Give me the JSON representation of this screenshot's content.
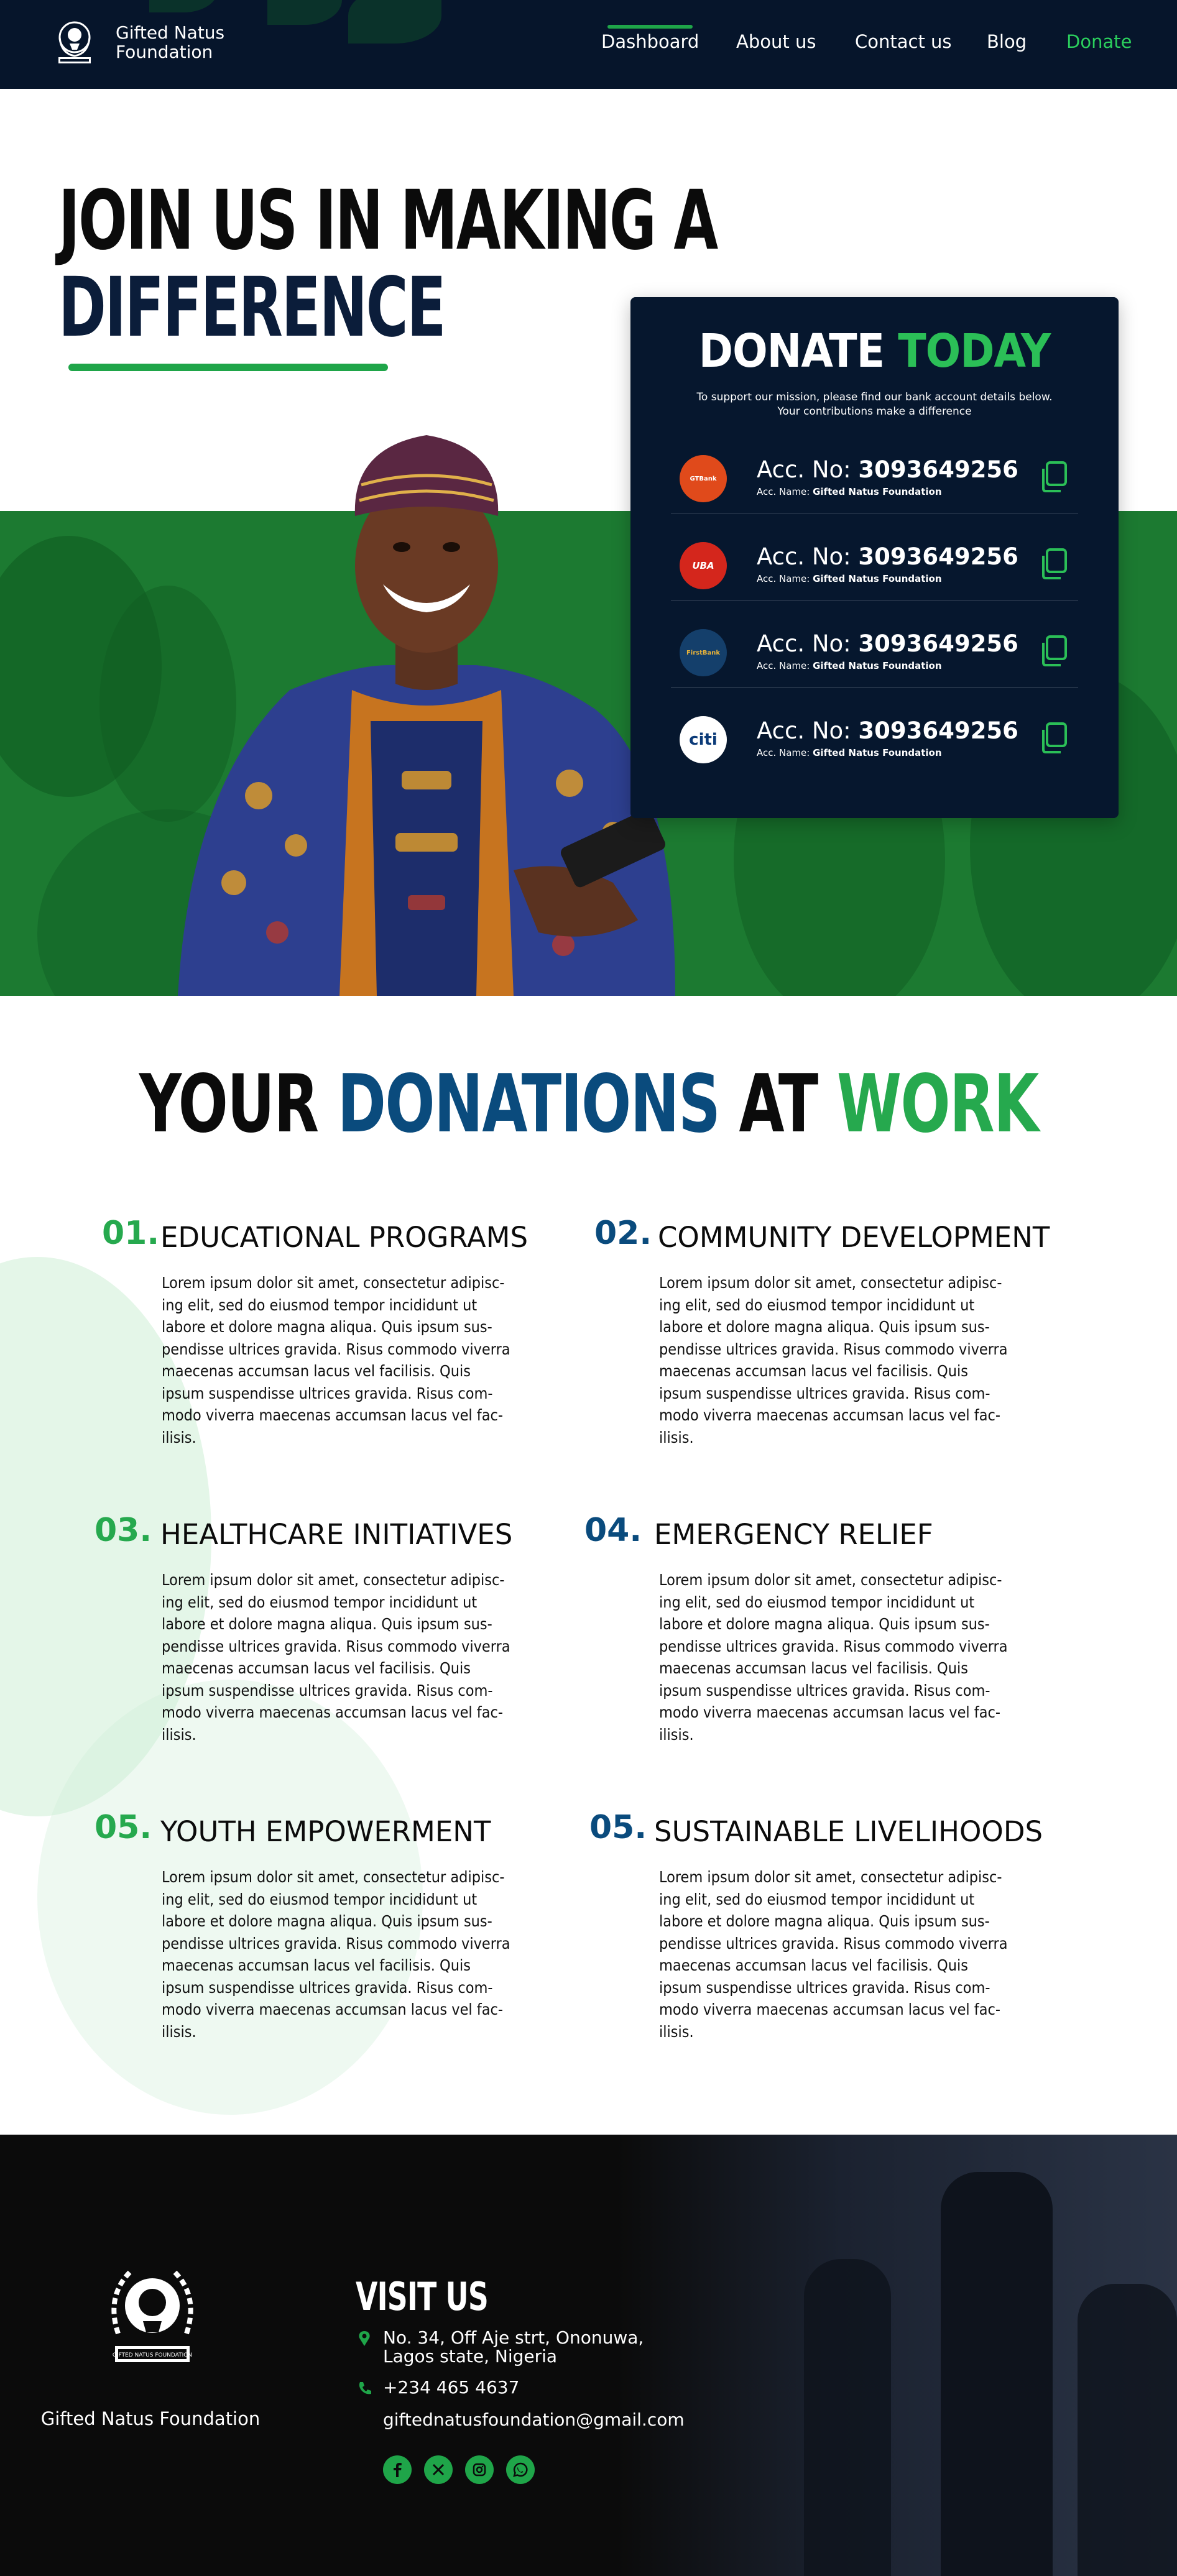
{
  "brand": {
    "name_line1": "Gifted Natus",
    "name_line2": "Foundation"
  },
  "nav": {
    "links": [
      "Dashboard",
      "About us",
      "Contact us",
      "Blog",
      "Donate"
    ],
    "active": "Dashboard"
  },
  "hero": {
    "title_line1": "JOIN US IN MAKING A",
    "title_line2": "DIFFERENCE"
  },
  "donate": {
    "title_word1": "DONATE",
    "title_word2": "TODAY",
    "subtitle_line1": "To support our mission, please find our bank account details below.",
    "subtitle_line2": "Your contributions make a difference",
    "acc_label": "Acc. No:",
    "accname_label": "Acc. Name:",
    "banks": [
      {
        "logo_text": "GTBank",
        "logo_icon": "gtbank-logo-icon",
        "color": "#e04a1b",
        "acc_no": "3093649256",
        "acc_name": "Gifted Natus Foundation"
      },
      {
        "logo_text": "UBA",
        "logo_icon": "uba-logo-icon",
        "color": "#d4261c",
        "acc_no": "3093649256",
        "acc_name": "Gifted Natus Foundation"
      },
      {
        "logo_text": "FirstBank",
        "logo_icon": "firstbank-logo-icon",
        "color": "#143f6b",
        "acc_no": "3093649256",
        "acc_name": "Gifted Natus Foundation"
      },
      {
        "logo_text": "citi",
        "logo_icon": "citibank-logo-icon",
        "color": "#ffffff",
        "acc_no": "3093649256",
        "acc_name": "Gifted Natus Foundation"
      }
    ]
  },
  "work": {
    "title_w1": "YOUR",
    "title_w2": "DONATIONS",
    "title_w3": "AT",
    "title_w4": "WORK",
    "items": [
      {
        "num": "01.",
        "head": "EDUCATIONAL PROGRAMS",
        "body": "Lorem ipsum dolor sit amet, consectetur adipisc-ing elit, sed do eiusmod tempor incididunt ut labore et dolore magna aliqua. Quis ipsum sus-pendisse ultrices gravida. Risus commodo viverra maecenas accumsan lacus vel facilisis. Quis ipsum suspendisse ultrices gravida. Risus com-modo viverra maecenas accumsan lacus vel fac-ilisis."
      },
      {
        "num": "02.",
        "head": "COMMUNITY DEVELOPMENT",
        "body": "Lorem ipsum dolor sit amet, consectetur adipisc-ing elit, sed do eiusmod tempor incididunt ut labore et dolore magna aliqua. Quis ipsum sus-pendisse ultrices gravida. Risus commodo viverra maecenas accumsan lacus vel facilisis. Quis ipsum suspendisse ultrices gravida. Risus com-modo viverra maecenas accumsan lacus vel fac-ilisis."
      },
      {
        "num": "03.",
        "head": "HEALTHCARE INITIATIVES",
        "body": "Lorem ipsum dolor sit amet, consectetur adipisc-ing elit, sed do eiusmod tempor incididunt ut labore et dolore magna aliqua. Quis ipsum sus-pendisse ultrices gravida. Risus commodo viverra maecenas accumsan lacus vel facilisis. Quis ipsum suspendisse ultrices gravida. Risus com-modo viverra maecenas accumsan lacus vel fac-ilisis."
      },
      {
        "num": "04.",
        "head": "EMERGENCY RELIEF",
        "body": "Lorem ipsum dolor sit amet, consectetur adipisc-ing elit, sed do eiusmod tempor incididunt ut labore et dolore magna aliqua. Quis ipsum sus-pendisse ultrices gravida. Risus commodo viverra maecenas accumsan lacus vel facilisis. Quis ipsum suspendisse ultrices gravida. Risus com-modo viverra maecenas accumsan lacus vel fac-ilisis."
      },
      {
        "num": "05.",
        "head": "YOUTH EMPOWERMENT",
        "body": "Lorem ipsum dolor sit amet, consectetur adipisc-ing elit, sed do eiusmod tempor incididunt ut labore et dolore magna aliqua. Quis ipsum sus-pendisse ultrices gravida. Risus commodo viverra maecenas accumsan lacus vel facilisis. Quis ipsum suspendisse ultrices gravida. Risus com-modo viverra maecenas accumsan lacus vel fac-ilisis."
      },
      {
        "num": "05.",
        "head": "SUSTAINABLE LIVELIHOODS",
        "body": "Lorem ipsum dolor sit amet, consectetur adipisc-ing elit, sed do eiusmod tempor incididunt ut labore et dolore magna aliqua. Quis ipsum sus-pendisse ultrices gravida. Risus commodo viverra maecenas accumsan lacus vel facilisis. Quis ipsum suspendisse ultrices gravida. Risus com-modo viverra maecenas accumsan lacus vel fac-ilisis."
      }
    ]
  },
  "footer": {
    "brand": "Gifted Natus Foundation",
    "visit_title": "VISIT US",
    "address_line1": "No. 34, Off Aje strt, Ononuwa,",
    "address_line2": "Lagos state, Nigeria",
    "phone": "+234 465 4637",
    "email": "giftednatusfoundation@gmail.com",
    "logo_caption": "GIFTED NATUS FOUNDATION",
    "socials": [
      "facebook-icon",
      "x-icon",
      "instagram-icon",
      "whatsapp-icon"
    ]
  },
  "colors": {
    "navy": "#06152b",
    "green": "#1fa549",
    "blue": "#0a4b7d"
  }
}
